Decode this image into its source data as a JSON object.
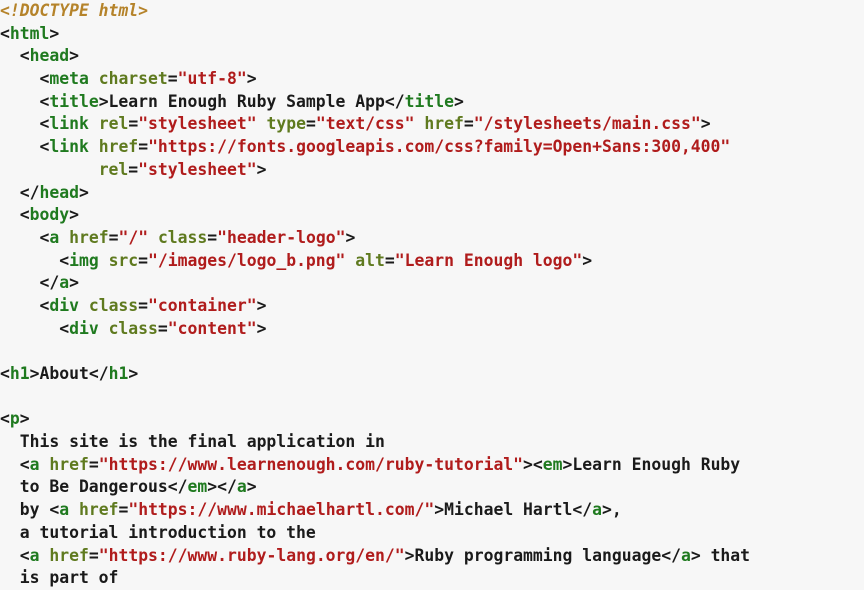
{
  "code_lines": [
    [
      {
        "c": "doctype",
        "t": "<!DOCTYPE html>"
      }
    ],
    [
      {
        "c": "text",
        "t": "<"
      },
      {
        "c": "tag",
        "t": "html"
      },
      {
        "c": "text",
        "t": ">"
      }
    ],
    [
      {
        "c": "text",
        "t": "  <"
      },
      {
        "c": "tag",
        "t": "head"
      },
      {
        "c": "text",
        "t": ">"
      }
    ],
    [
      {
        "c": "text",
        "t": "    <"
      },
      {
        "c": "tag",
        "t": "meta"
      },
      {
        "c": "text",
        "t": " "
      },
      {
        "c": "attr",
        "t": "charset"
      },
      {
        "c": "text",
        "t": "="
      },
      {
        "c": "str",
        "t": "\"utf-8\""
      },
      {
        "c": "text",
        "t": ">"
      }
    ],
    [
      {
        "c": "text",
        "t": "    <"
      },
      {
        "c": "tag",
        "t": "title"
      },
      {
        "c": "text",
        "t": ">Learn Enough Ruby Sample App</"
      },
      {
        "c": "tag",
        "t": "title"
      },
      {
        "c": "text",
        "t": ">"
      }
    ],
    [
      {
        "c": "text",
        "t": "    <"
      },
      {
        "c": "tag",
        "t": "link"
      },
      {
        "c": "text",
        "t": " "
      },
      {
        "c": "attr",
        "t": "rel"
      },
      {
        "c": "text",
        "t": "="
      },
      {
        "c": "str",
        "t": "\"stylesheet\""
      },
      {
        "c": "text",
        "t": " "
      },
      {
        "c": "attr",
        "t": "type"
      },
      {
        "c": "text",
        "t": "="
      },
      {
        "c": "str",
        "t": "\"text/css\""
      },
      {
        "c": "text",
        "t": " "
      },
      {
        "c": "attr",
        "t": "href"
      },
      {
        "c": "text",
        "t": "="
      },
      {
        "c": "str",
        "t": "\"/stylesheets/main.css\""
      },
      {
        "c": "text",
        "t": ">"
      }
    ],
    [
      {
        "c": "text",
        "t": "    <"
      },
      {
        "c": "tag",
        "t": "link"
      },
      {
        "c": "text",
        "t": " "
      },
      {
        "c": "attr",
        "t": "href"
      },
      {
        "c": "text",
        "t": "="
      },
      {
        "c": "str",
        "t": "\"https://fonts.googleapis.com/css?family=Open+Sans:300,400\""
      }
    ],
    [
      {
        "c": "text",
        "t": "          "
      },
      {
        "c": "attr",
        "t": "rel"
      },
      {
        "c": "text",
        "t": "="
      },
      {
        "c": "str",
        "t": "\"stylesheet\""
      },
      {
        "c": "text",
        "t": ">"
      }
    ],
    [
      {
        "c": "text",
        "t": "  </"
      },
      {
        "c": "tag",
        "t": "head"
      },
      {
        "c": "text",
        "t": ">"
      }
    ],
    [
      {
        "c": "text",
        "t": "  <"
      },
      {
        "c": "tag",
        "t": "body"
      },
      {
        "c": "text",
        "t": ">"
      }
    ],
    [
      {
        "c": "text",
        "t": "    <"
      },
      {
        "c": "tag",
        "t": "a"
      },
      {
        "c": "text",
        "t": " "
      },
      {
        "c": "attr",
        "t": "href"
      },
      {
        "c": "text",
        "t": "="
      },
      {
        "c": "str",
        "t": "\"/\""
      },
      {
        "c": "text",
        "t": " "
      },
      {
        "c": "attr",
        "t": "class"
      },
      {
        "c": "text",
        "t": "="
      },
      {
        "c": "str",
        "t": "\"header-logo\""
      },
      {
        "c": "text",
        "t": ">"
      }
    ],
    [
      {
        "c": "text",
        "t": "      <"
      },
      {
        "c": "tag",
        "t": "img"
      },
      {
        "c": "text",
        "t": " "
      },
      {
        "c": "attr",
        "t": "src"
      },
      {
        "c": "text",
        "t": "="
      },
      {
        "c": "str",
        "t": "\"/images/logo_b.png\""
      },
      {
        "c": "text",
        "t": " "
      },
      {
        "c": "attr",
        "t": "alt"
      },
      {
        "c": "text",
        "t": "="
      },
      {
        "c": "str",
        "t": "\"Learn Enough logo\""
      },
      {
        "c": "text",
        "t": ">"
      }
    ],
    [
      {
        "c": "text",
        "t": "    </"
      },
      {
        "c": "tag",
        "t": "a"
      },
      {
        "c": "text",
        "t": ">"
      }
    ],
    [
      {
        "c": "text",
        "t": "    <"
      },
      {
        "c": "tag",
        "t": "div"
      },
      {
        "c": "text",
        "t": " "
      },
      {
        "c": "attr",
        "t": "class"
      },
      {
        "c": "text",
        "t": "="
      },
      {
        "c": "str",
        "t": "\"container\""
      },
      {
        "c": "text",
        "t": ">"
      }
    ],
    [
      {
        "c": "text",
        "t": "      <"
      },
      {
        "c": "tag",
        "t": "div"
      },
      {
        "c": "text",
        "t": " "
      },
      {
        "c": "attr",
        "t": "class"
      },
      {
        "c": "text",
        "t": "="
      },
      {
        "c": "str",
        "t": "\"content\""
      },
      {
        "c": "text",
        "t": ">"
      }
    ],
    [
      {
        "c": "text",
        "t": ""
      }
    ],
    [
      {
        "c": "text",
        "t": "<"
      },
      {
        "c": "tag",
        "t": "h1"
      },
      {
        "c": "text",
        "t": ">About</"
      },
      {
        "c": "tag",
        "t": "h1"
      },
      {
        "c": "text",
        "t": ">"
      }
    ],
    [
      {
        "c": "text",
        "t": ""
      }
    ],
    [
      {
        "c": "text",
        "t": "<"
      },
      {
        "c": "tag",
        "t": "p"
      },
      {
        "c": "text",
        "t": ">"
      }
    ],
    [
      {
        "c": "text",
        "t": "  This site is the final application in"
      }
    ],
    [
      {
        "c": "text",
        "t": "  <"
      },
      {
        "c": "tag",
        "t": "a"
      },
      {
        "c": "text",
        "t": " "
      },
      {
        "c": "attr",
        "t": "href"
      },
      {
        "c": "text",
        "t": "="
      },
      {
        "c": "str",
        "t": "\"https://www.learnenough.com/ruby-tutorial\""
      },
      {
        "c": "text",
        "t": "><"
      },
      {
        "c": "tag",
        "t": "em"
      },
      {
        "c": "text",
        "t": ">Learn Enough Ruby"
      }
    ],
    [
      {
        "c": "text",
        "t": "  to Be Dangerous</"
      },
      {
        "c": "tag",
        "t": "em"
      },
      {
        "c": "text",
        "t": "></"
      },
      {
        "c": "tag",
        "t": "a"
      },
      {
        "c": "text",
        "t": ">"
      }
    ],
    [
      {
        "c": "text",
        "t": "  by <"
      },
      {
        "c": "tag",
        "t": "a"
      },
      {
        "c": "text",
        "t": " "
      },
      {
        "c": "attr",
        "t": "href"
      },
      {
        "c": "text",
        "t": "="
      },
      {
        "c": "str",
        "t": "\"https://www.michaelhartl.com/\""
      },
      {
        "c": "text",
        "t": ">Michael Hartl</"
      },
      {
        "c": "tag",
        "t": "a"
      },
      {
        "c": "text",
        "t": ">,"
      }
    ],
    [
      {
        "c": "text",
        "t": "  a tutorial introduction to the"
      }
    ],
    [
      {
        "c": "text",
        "t": "  <"
      },
      {
        "c": "tag",
        "t": "a"
      },
      {
        "c": "text",
        "t": " "
      },
      {
        "c": "attr",
        "t": "href"
      },
      {
        "c": "text",
        "t": "="
      },
      {
        "c": "str",
        "t": "\"https://www.ruby-lang.org/en/\""
      },
      {
        "c": "text",
        "t": ">Ruby programming language</"
      },
      {
        "c": "tag",
        "t": "a"
      },
      {
        "c": "text",
        "t": "> that"
      }
    ],
    [
      {
        "c": "text",
        "t": "  is part of"
      }
    ]
  ],
  "colors": {
    "background": "#f7f7f7",
    "doctype": "#b5832a",
    "tag": "#1f7a1f",
    "attr": "#5f7a1f",
    "string": "#b01c1c",
    "text": "#1a1a1a"
  }
}
